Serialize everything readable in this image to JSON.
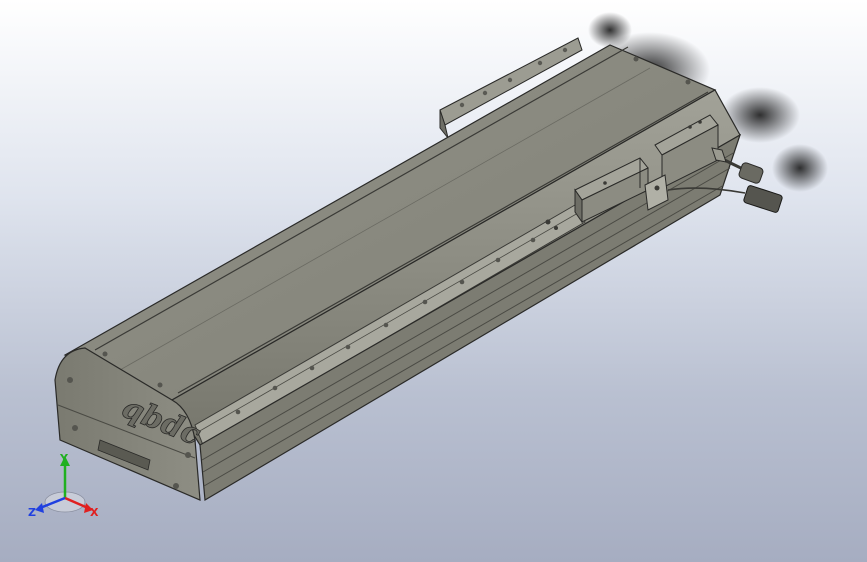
{
  "viewport": {
    "background_top": "#ffffff",
    "background_bottom": "#a6adc1"
  },
  "model": {
    "logo_text": "qbdc",
    "body_color": "#8a8a80",
    "edge_color": "#2a2a28",
    "plate_color": "#9a9a90"
  },
  "triad": {
    "x_label": "X",
    "y_label": "Y",
    "z_label": "Z",
    "x_color": "#e02020",
    "y_color": "#20b020",
    "z_color": "#2040e0"
  }
}
